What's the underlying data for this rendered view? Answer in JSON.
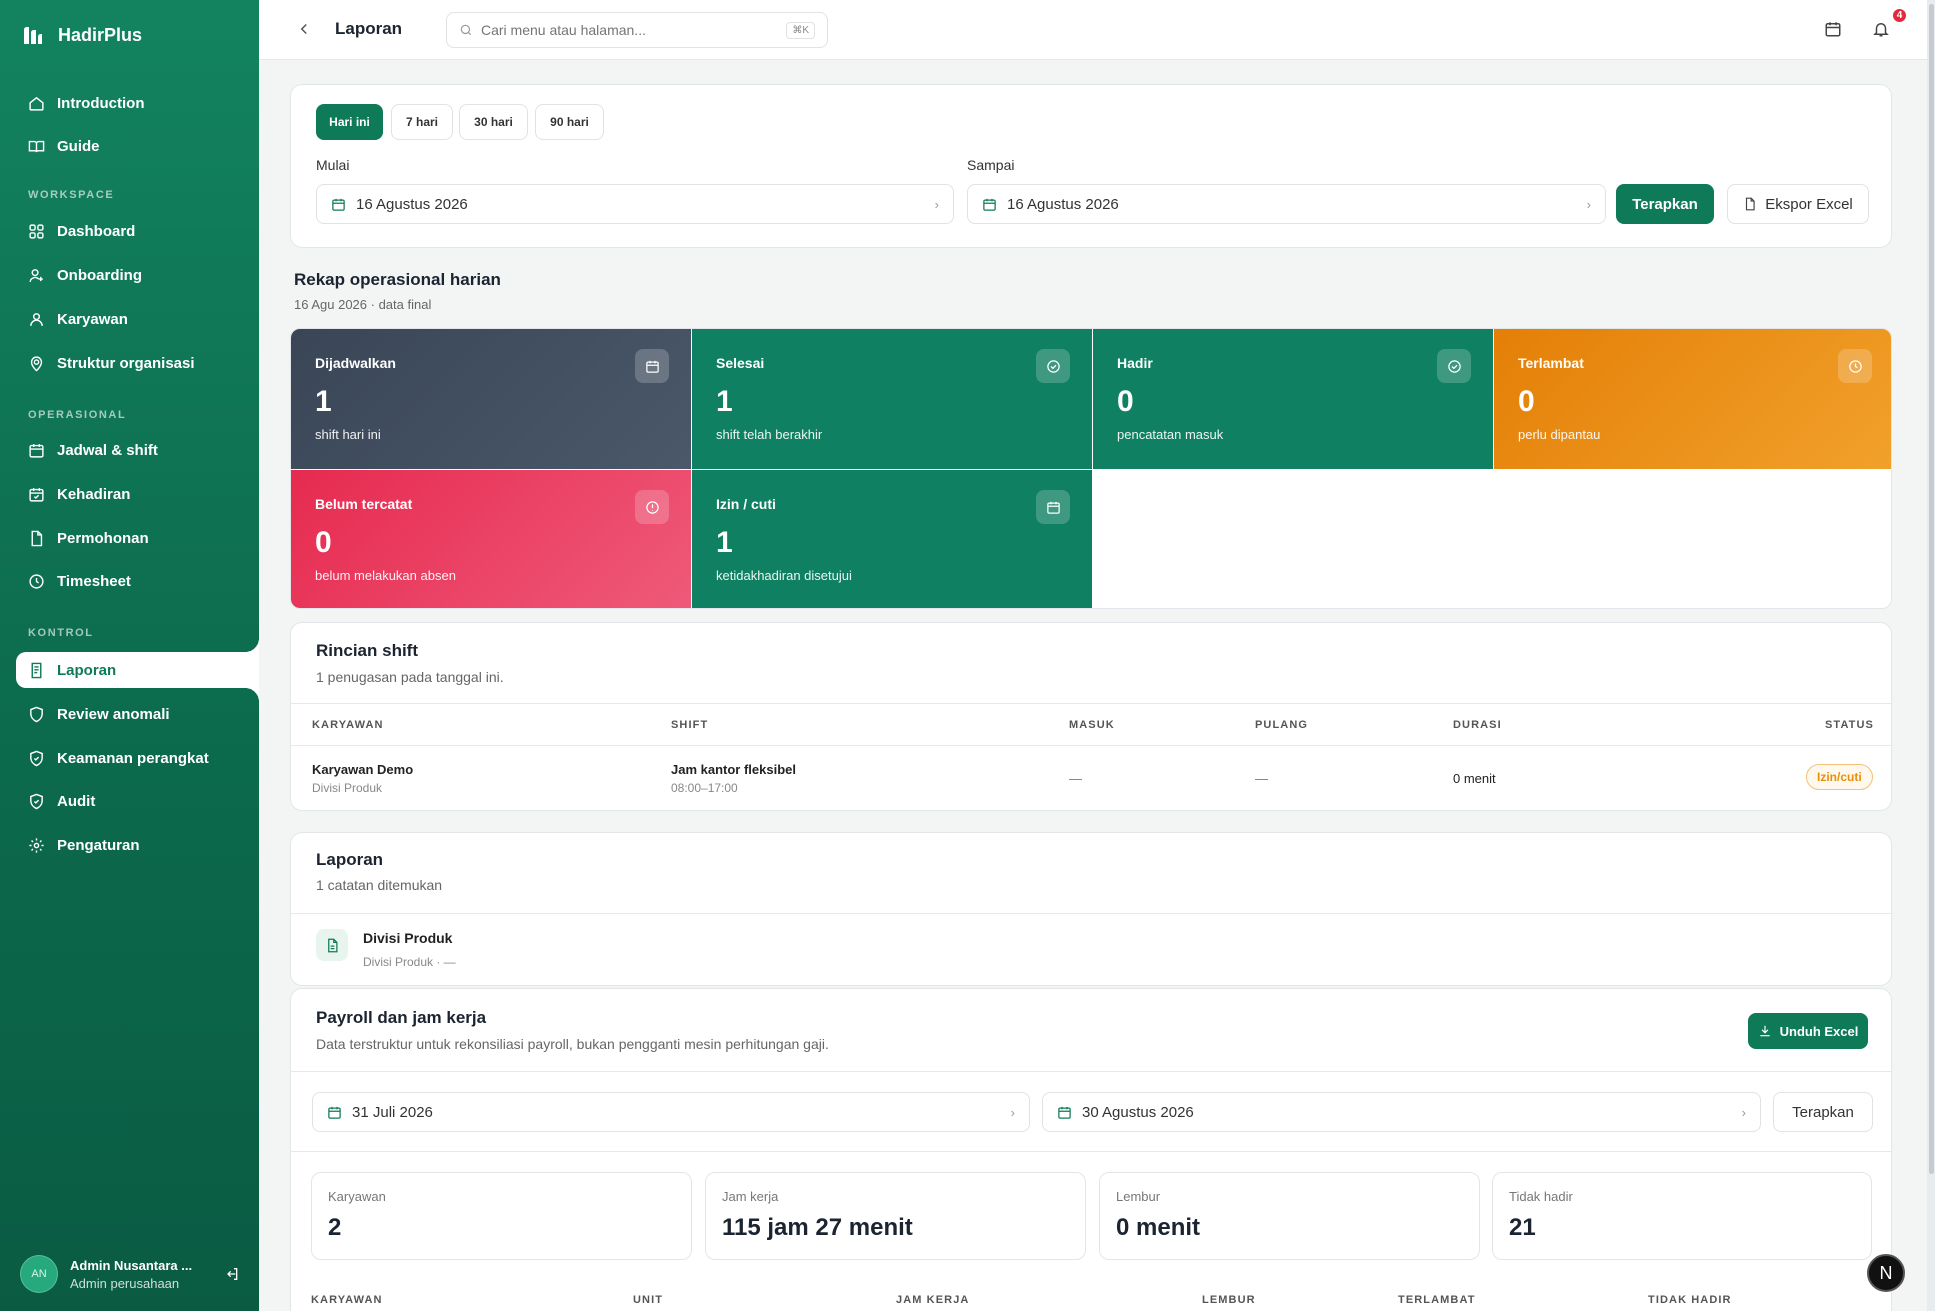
{
  "app": {
    "name": "HadirPlus"
  },
  "sidebar": {
    "top_items": [
      {
        "label": "Introduction"
      },
      {
        "label": "Guide"
      }
    ],
    "sections": {
      "workspace": "WORKSPACE",
      "operasional": "OPERASIONAL",
      "kontrol": "KONTROL"
    },
    "workspace_items": [
      {
        "label": "Dashboard"
      },
      {
        "label": "Onboarding"
      },
      {
        "label": "Karyawan"
      },
      {
        "label": "Struktur organisasi"
      }
    ],
    "operasional_items": [
      {
        "label": "Jadwal & shift"
      },
      {
        "label": "Kehadiran"
      },
      {
        "label": "Permohonan"
      },
      {
        "label": "Timesheet"
      }
    ],
    "kontrol_items": [
      {
        "label": "Laporan",
        "active": true
      },
      {
        "label": "Review anomali"
      },
      {
        "label": "Keamanan perangkat"
      },
      {
        "label": "Audit"
      },
      {
        "label": "Pengaturan"
      }
    ],
    "user": {
      "initials": "AN",
      "name": "Admin Nusantara ...",
      "role": "Admin perusahaan"
    }
  },
  "topbar": {
    "title": "Laporan",
    "search_placeholder": "Cari menu atau halaman...",
    "shortcut": "⌘K",
    "notification_count": "4"
  },
  "filter": {
    "ranges": [
      {
        "label": "Hari ini",
        "selected": true
      },
      {
        "label": "7 hari"
      },
      {
        "label": "30 hari"
      },
      {
        "label": "90 hari"
      }
    ],
    "start_label": "Mulai",
    "start_value": "16 Agustus 2026",
    "end_label": "Sampai",
    "end_value": "16 Agustus 2026",
    "apply_label": "Terapkan",
    "export_label": "Ekspor Excel"
  },
  "rekap": {
    "title": "Rekap operasional harian",
    "subtitle": "16 Agu 2026 · data final",
    "tiles": [
      {
        "label": "Dijadwalkan",
        "value": "1",
        "sub": "shift hari ini",
        "color": "#3a4656"
      },
      {
        "label": "Selesai",
        "value": "1",
        "sub": "shift telah berakhir",
        "color": "#0f8062"
      },
      {
        "label": "Hadir",
        "value": "0",
        "sub": "pencatatan masuk",
        "color": "#0f8062"
      },
      {
        "label": "Terlambat",
        "value": "0",
        "sub": "perlu dipantau",
        "color": "#ea8a0b"
      },
      {
        "label": "Belum tercatat",
        "value": "0",
        "sub": "belum melakukan absen",
        "color": "#e9395a"
      },
      {
        "label": "Izin / cuti",
        "value": "1",
        "sub": "ketidakhadiran disetujui",
        "color": "#0f8062"
      }
    ]
  },
  "rincian": {
    "title": "Rincian shift",
    "subtitle": "1 penugasan pada tanggal ini.",
    "headers": [
      "KARYAWAN",
      "SHIFT",
      "MASUK",
      "PULANG",
      "DURASI",
      "STATUS"
    ],
    "rows": [
      {
        "name": "Karyawan Demo",
        "unit": "Divisi Produk",
        "shift": "Jam kantor fleksibel",
        "shift_time": "08:00–17:00",
        "masuk": "—",
        "pulang": "—",
        "durasi": "0 menit",
        "status": "Izin/cuti"
      }
    ]
  },
  "laporan": {
    "title": "Laporan",
    "subtitle": "1 catatan ditemukan",
    "items": [
      {
        "title": "Divisi Produk",
        "meta": "Divisi Produk · —"
      }
    ]
  },
  "payroll": {
    "title": "Payroll dan jam kerja",
    "subtitle": "Data terstruktur untuk rekonsiliasi payroll, bukan pengganti mesin perhitungan gaji.",
    "download_label": "Unduh Excel",
    "start_value": "31 Juli 2026",
    "end_value": "30 Agustus 2026",
    "apply_label": "Terapkan",
    "stats": [
      {
        "label": "Karyawan",
        "value": "2"
      },
      {
        "label": "Jam kerja",
        "value": "115 jam 27 menit"
      },
      {
        "label": "Lembur",
        "value": "0 menit"
      },
      {
        "label": "Tidak hadir",
        "value": "21"
      }
    ],
    "headers": [
      "KARYAWAN",
      "UNIT",
      "JAM KERJA",
      "LEMBUR",
      "TERLAMBAT",
      "TIDAK HADIR"
    ]
  },
  "fab": {
    "label": "N"
  }
}
